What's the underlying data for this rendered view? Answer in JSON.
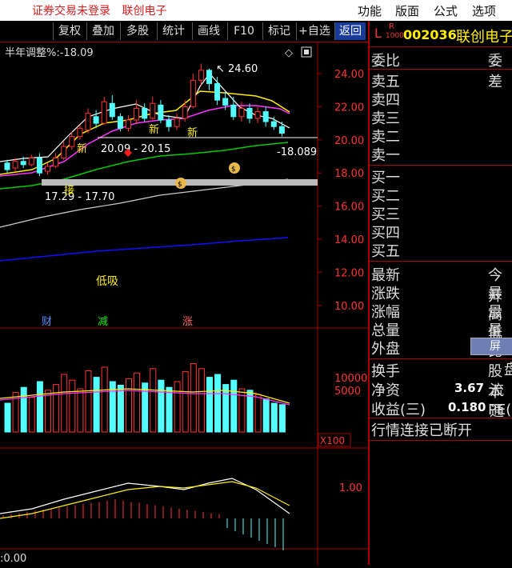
{
  "menubar": {
    "status": "证券交易未登录",
    "stock_name": "联创电子",
    "menus": [
      "功能",
      "版面",
      "公式",
      "选项"
    ]
  },
  "toolbar": {
    "buttons": [
      "复权",
      "叠加",
      "多股",
      "统计",
      "画线",
      "F10",
      "标记",
      "+自选",
      "返回"
    ]
  },
  "chart": {
    "indicator_label": "半年调整%:-18.09",
    "price_ticks": [
      "24.00",
      "22.00",
      "20.00",
      "18.00",
      "16.00",
      "14.00",
      "12.00",
      "10.00"
    ],
    "annotations": {
      "high": "24.60",
      "zone1": "20.09 - 20.15",
      "zone2": "17.29 - 17.70",
      "pct": "-18.089",
      "low_buy": "低吸",
      "xin": "新",
      "jie": "接"
    },
    "event_markers": [
      "财",
      "减",
      "涨"
    ],
    "volume_ticks": [
      "10000",
      "5000"
    ],
    "volume_unit": "X100",
    "macd_tick": "1.00",
    "bottom_value": ":0.00"
  },
  "quote": {
    "market_l": "L",
    "market_r": "R",
    "market_code": "1000",
    "code": "002036",
    "name": "联创电子",
    "weibi_label": "委比",
    "weicha_label": "委差",
    "sell": [
      "卖五",
      "卖四",
      "卖三",
      "卖二",
      "卖一"
    ],
    "buy": [
      "买一",
      "买二",
      "买三",
      "买四",
      "买五"
    ],
    "stats_left": [
      "最新",
      "涨跌",
      "涨幅",
      "总量",
      "外盘"
    ],
    "stats_right": [
      "今开",
      "最高",
      "最低",
      "量比",
      "内盘"
    ],
    "turnover_label": "换手",
    "equity_label": "股本",
    "netasset_label": "净资",
    "netasset_value": "3.67",
    "float_label": "流通",
    "eps_label": "收益(三)",
    "eps_value": "0.180",
    "pe_label": "PE(动)",
    "screen_button": "屏",
    "connection_status": "行情连接已断开"
  },
  "colors": {
    "up": "#ff3333",
    "down": "#54ffff",
    "grid": "#a00000",
    "ma_white": "#ffffff",
    "ma_yellow": "#ffee00",
    "ma_magenta": "#ff00ff",
    "ma_green": "#00cc00",
    "ma_blue": "#0000ff"
  }
}
